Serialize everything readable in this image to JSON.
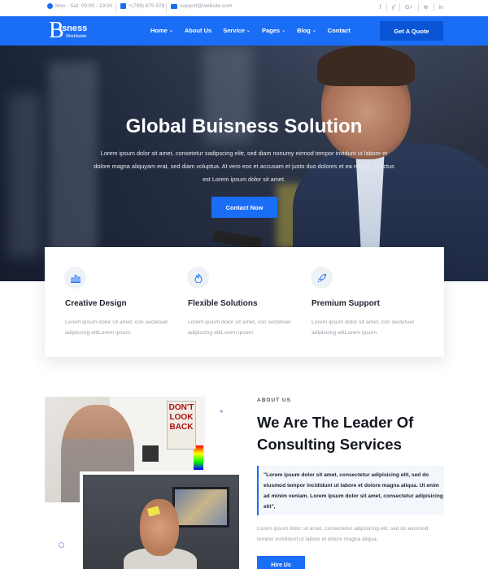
{
  "topbar": {
    "hours": "Mon - Sat: 09:00 - 19:00",
    "phone": "+(789) 675 978",
    "email": "support@website.com",
    "socials": [
      "f",
      "ƴ",
      "G+",
      "⊕",
      "in"
    ]
  },
  "nav": {
    "logo_letter": "B",
    "logo_name": "isness",
    "logo_sub": "Worldwide",
    "items": [
      {
        "label": "Home",
        "dropdown": true
      },
      {
        "label": "About Us",
        "dropdown": false
      },
      {
        "label": "Service",
        "dropdown": true
      },
      {
        "label": "Pages",
        "dropdown": true
      },
      {
        "label": "Blog",
        "dropdown": true
      },
      {
        "label": "Contact",
        "dropdown": false
      }
    ],
    "cta": "Get A Quote"
  },
  "hero": {
    "title": "Global Buisness Solution",
    "text": "Lorem ipsum dolor sit amet, consetetur sadipscing elitr, sed diam nonumy eirmod tempor invidunt ut labore et dolore magna aliquyam erat, sed diam voluptua. At vero eos et accusam et justo duo dolores et ea rebum, sanctus est Lorem ipsum dolor sit amet.",
    "button": "Contact Now"
  },
  "features": [
    {
      "icon": "bar-chart-icon",
      "title": "Creative Design",
      "text": "Lorem ipsum dolor sit amet, con sectetuer adipiscing elitLorem ipsum"
    },
    {
      "icon": "flame-icon",
      "title": "Flexible Solutions",
      "text": "Lorem ipsum dolor sit amet, con sectetuer adipiscing elitLorem ipsum"
    },
    {
      "icon": "rocket-icon",
      "title": "Premium Support",
      "text": "Lorem ipsum dolor sit amet, con sectetuer adipiscing elitLorem ipsum"
    }
  ],
  "about": {
    "label": "ABOUT US",
    "title": "We Are The Leader Of Consulting Services",
    "quote": "\"Lorem ipsum dolor sit amet, consectetur adipisicing elit, sed do eiusmod tempor incididunt ut labore et dolore magna aliqua. Ut enim ad minim veniam. Lorem ipsum dolor sit amet, consectetur adipisicing elit\",",
    "text": "Lorem ipsum dolor sit amet, consectetur adipisicing elit, sed do eiusmod tempor incididunt ut labore et dolore magna aliqua.",
    "button": "Hire Us",
    "poster_text": "DON'T LOOK BACK"
  },
  "colors": {
    "primary": "#1a6df5",
    "dark": "#12161f",
    "muted": "#9aa0ab"
  }
}
